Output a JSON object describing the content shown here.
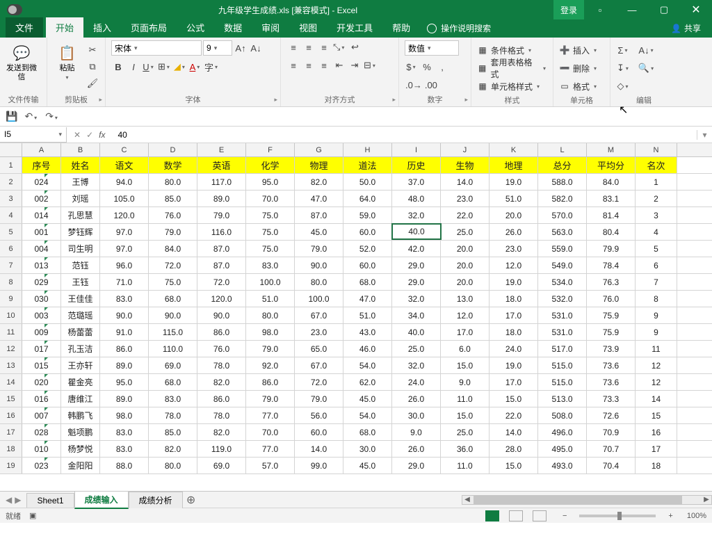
{
  "title": "九年级学生成绩.xls  [兼容模式]  -  Excel",
  "window": {
    "login": "登录"
  },
  "tabs": {
    "file": "文件",
    "home": "开始",
    "insert": "插入",
    "layout": "页面布局",
    "formulas": "公式",
    "data": "数据",
    "review": "审阅",
    "view": "视图",
    "dev": "开发工具",
    "help": "帮助",
    "tell": "操作说明搜索",
    "share": "共享"
  },
  "ribbon": {
    "wechat": "发送到微信",
    "transfer": "文件传输",
    "paste": "粘贴",
    "clipboard": "剪贴板",
    "font_name": "宋体",
    "font_size": "9",
    "font_group": "字体",
    "align_group": "对齐方式",
    "number_group": "数字",
    "number_format": "数值",
    "styles_group": "样式",
    "cond": "条件格式",
    "tblfmt": "套用表格格式",
    "cellsty": "单元格样式",
    "cells_group": "单元格",
    "ins": "插入",
    "del": "删除",
    "fmt": "格式",
    "edit_group": "编辑"
  },
  "namebox": "I5",
  "formula": "40",
  "columns": [
    "A",
    "B",
    "C",
    "D",
    "E",
    "F",
    "G",
    "H",
    "I",
    "J",
    "K",
    "L",
    "M",
    "N"
  ],
  "headers": [
    "序号",
    "姓名",
    "语文",
    "数学",
    "英语",
    "化学",
    "物理",
    "道法",
    "历史",
    "生物",
    "地理",
    "总分",
    "平均分",
    "名次"
  ],
  "rows": [
    [
      "024",
      "王博",
      "94.0",
      "80.0",
      "117.0",
      "95.0",
      "82.0",
      "50.0",
      "37.0",
      "14.0",
      "19.0",
      "588.0",
      "84.0",
      "1"
    ],
    [
      "002",
      "刘瑶",
      "105.0",
      "85.0",
      "89.0",
      "70.0",
      "47.0",
      "64.0",
      "48.0",
      "23.0",
      "51.0",
      "582.0",
      "83.1",
      "2"
    ],
    [
      "014",
      "孔思慧",
      "120.0",
      "76.0",
      "79.0",
      "75.0",
      "87.0",
      "59.0",
      "32.0",
      "22.0",
      "20.0",
      "570.0",
      "81.4",
      "3"
    ],
    [
      "001",
      "梦钰辉",
      "97.0",
      "79.0",
      "116.0",
      "75.0",
      "45.0",
      "60.0",
      "40.0",
      "25.0",
      "26.0",
      "563.0",
      "80.4",
      "4"
    ],
    [
      "004",
      "司生明",
      "97.0",
      "84.0",
      "87.0",
      "75.0",
      "79.0",
      "52.0",
      "42.0",
      "20.0",
      "23.0",
      "559.0",
      "79.9",
      "5"
    ],
    [
      "013",
      "范钰",
      "96.0",
      "72.0",
      "87.0",
      "83.0",
      "90.0",
      "60.0",
      "29.0",
      "20.0",
      "12.0",
      "549.0",
      "78.4",
      "6"
    ],
    [
      "029",
      "王钰",
      "71.0",
      "75.0",
      "72.0",
      "100.0",
      "80.0",
      "68.0",
      "29.0",
      "20.0",
      "19.0",
      "534.0",
      "76.3",
      "7"
    ],
    [
      "030",
      "王佳佳",
      "83.0",
      "68.0",
      "120.0",
      "51.0",
      "100.0",
      "47.0",
      "32.0",
      "13.0",
      "18.0",
      "532.0",
      "76.0",
      "8"
    ],
    [
      "003",
      "范璐瑶",
      "90.0",
      "90.0",
      "90.0",
      "80.0",
      "67.0",
      "51.0",
      "34.0",
      "12.0",
      "17.0",
      "531.0",
      "75.9",
      "9"
    ],
    [
      "009",
      "杨蕾蕾",
      "91.0",
      "115.0",
      "86.0",
      "98.0",
      "23.0",
      "43.0",
      "40.0",
      "17.0",
      "18.0",
      "531.0",
      "75.9",
      "9"
    ],
    [
      "017",
      "孔玉洁",
      "86.0",
      "110.0",
      "76.0",
      "79.0",
      "65.0",
      "46.0",
      "25.0",
      "6.0",
      "24.0",
      "517.0",
      "73.9",
      "11"
    ],
    [
      "015",
      "王亦轩",
      "89.0",
      "69.0",
      "78.0",
      "92.0",
      "67.0",
      "54.0",
      "32.0",
      "15.0",
      "19.0",
      "515.0",
      "73.6",
      "12"
    ],
    [
      "020",
      "瞿金亮",
      "95.0",
      "68.0",
      "82.0",
      "86.0",
      "72.0",
      "62.0",
      "24.0",
      "9.0",
      "17.0",
      "515.0",
      "73.6",
      "12"
    ],
    [
      "016",
      "唐维江",
      "89.0",
      "83.0",
      "86.0",
      "79.0",
      "79.0",
      "45.0",
      "26.0",
      "11.0",
      "15.0",
      "513.0",
      "73.3",
      "14"
    ],
    [
      "007",
      "韩鹏飞",
      "98.0",
      "78.0",
      "78.0",
      "77.0",
      "56.0",
      "54.0",
      "30.0",
      "15.0",
      "22.0",
      "508.0",
      "72.6",
      "15"
    ],
    [
      "028",
      "魁项鹏",
      "83.0",
      "85.0",
      "82.0",
      "70.0",
      "60.0",
      "68.0",
      "9.0",
      "25.0",
      "14.0",
      "496.0",
      "70.9",
      "16"
    ],
    [
      "010",
      "杨梦悦",
      "83.0",
      "82.0",
      "119.0",
      "77.0",
      "14.0",
      "30.0",
      "26.0",
      "36.0",
      "28.0",
      "495.0",
      "70.7",
      "17"
    ],
    [
      "023",
      "金阳阳",
      "88.0",
      "80.0",
      "69.0",
      "57.0",
      "99.0",
      "45.0",
      "29.0",
      "11.0",
      "15.0",
      "493.0",
      "70.4",
      "18"
    ]
  ],
  "sheets": {
    "s1": "Sheet1",
    "s2": "成绩输入",
    "s3": "成绩分析"
  },
  "status": {
    "ready": "就绪",
    "zoom": "100%"
  },
  "chart_data": {
    "type": "table",
    "title": "九年级学生成绩",
    "columns": [
      "序号",
      "姓名",
      "语文",
      "数学",
      "英语",
      "化学",
      "物理",
      "道法",
      "历史",
      "生物",
      "地理",
      "总分",
      "平均分",
      "名次"
    ],
    "data": [
      [
        "024",
        "王博",
        94,
        80,
        117,
        95,
        82,
        50,
        37,
        14,
        19,
        588,
        84.0,
        1
      ],
      [
        "002",
        "刘瑶",
        105,
        85,
        89,
        70,
        47,
        64,
        48,
        23,
        51,
        582,
        83.1,
        2
      ],
      [
        "014",
        "孔思慧",
        120,
        76,
        79,
        75,
        87,
        59,
        32,
        22,
        20,
        570,
        81.4,
        3
      ],
      [
        "001",
        "梦钰辉",
        97,
        79,
        116,
        75,
        45,
        60,
        40,
        25,
        26,
        563,
        80.4,
        4
      ],
      [
        "004",
        "司生明",
        97,
        84,
        87,
        75,
        79,
        52,
        42,
        20,
        23,
        559,
        79.9,
        5
      ],
      [
        "013",
        "范钰",
        96,
        72,
        87,
        83,
        90,
        60,
        29,
        20,
        12,
        549,
        78.4,
        6
      ],
      [
        "029",
        "王钰",
        71,
        75,
        72,
        100,
        80,
        68,
        29,
        20,
        19,
        534,
        76.3,
        7
      ],
      [
        "030",
        "王佳佳",
        83,
        68,
        120,
        51,
        100,
        47,
        32,
        13,
        18,
        532,
        76.0,
        8
      ],
      [
        "003",
        "范璐瑶",
        90,
        90,
        90,
        80,
        67,
        51,
        34,
        12,
        17,
        531,
        75.9,
        9
      ],
      [
        "009",
        "杨蕾蕾",
        91,
        115,
        86,
        98,
        23,
        43,
        40,
        17,
        18,
        531,
        75.9,
        9
      ],
      [
        "017",
        "孔玉洁",
        86,
        110,
        76,
        79,
        65,
        46,
        25,
        6,
        24,
        517,
        73.9,
        11
      ],
      [
        "015",
        "王亦轩",
        89,
        69,
        78,
        92,
        67,
        54,
        32,
        15,
        19,
        515,
        73.6,
        12
      ],
      [
        "020",
        "瞿金亮",
        95,
        68,
        82,
        86,
        72,
        62,
        24,
        9,
        17,
        515,
        73.6,
        12
      ],
      [
        "016",
        "唐维江",
        89,
        83,
        86,
        79,
        79,
        45,
        26,
        11,
        15,
        513,
        73.3,
        14
      ],
      [
        "007",
        "韩鹏飞",
        98,
        78,
        78,
        77,
        56,
        54,
        30,
        15,
        22,
        508,
        72.6,
        15
      ],
      [
        "028",
        "魁项鹏",
        83,
        85,
        82,
        70,
        60,
        68,
        9,
        25,
        14,
        496,
        70.9,
        16
      ],
      [
        "010",
        "杨梦悦",
        83,
        82,
        119,
        77,
        14,
        30,
        26,
        36,
        28,
        495,
        70.7,
        17
      ],
      [
        "023",
        "金阳阳",
        88,
        80,
        69,
        57,
        99,
        45,
        29,
        11,
        15,
        493,
        70.4,
        18
      ]
    ]
  }
}
